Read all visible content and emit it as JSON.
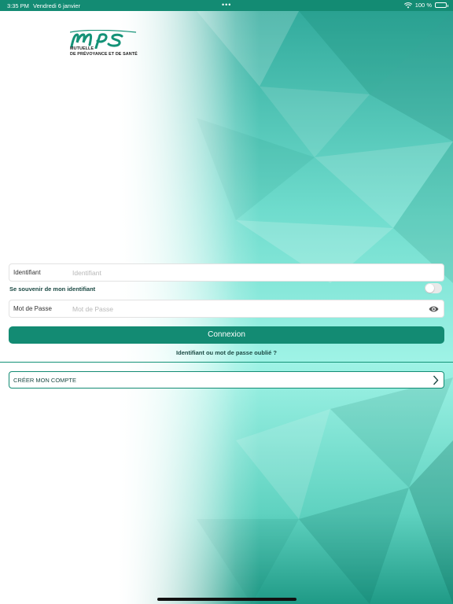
{
  "status_bar": {
    "time": "3:35 PM",
    "date": "Vendredi 6 janvier",
    "dots": "•••",
    "battery_text": "100 %"
  },
  "logo": {
    "brand": "mps",
    "tagline_line1": "MUTUELLE",
    "tagline_line2": "DE PRÉVOYANCE ET DE SANTÉ",
    "color": "#149277"
  },
  "login": {
    "identifiant_label": "Identifiant",
    "identifiant_placeholder": "Identifiant",
    "remember_label": "Se souvenir de mon identifiant",
    "remember_on": false,
    "password_label": "Mot de Passe",
    "password_placeholder": "Mot de Passe",
    "connexion_label": "Connexion",
    "forgot_link": "Identifiant ou mot de passe oublié ?"
  },
  "create_account": {
    "label": "CRÉER MON COMPTE"
  },
  "colors": {
    "primary": "#138b73",
    "text_dark": "#1c4a44"
  },
  "icons": [
    "wifi-icon",
    "battery-icon",
    "eye-icon",
    "chevron-right-icon"
  ]
}
